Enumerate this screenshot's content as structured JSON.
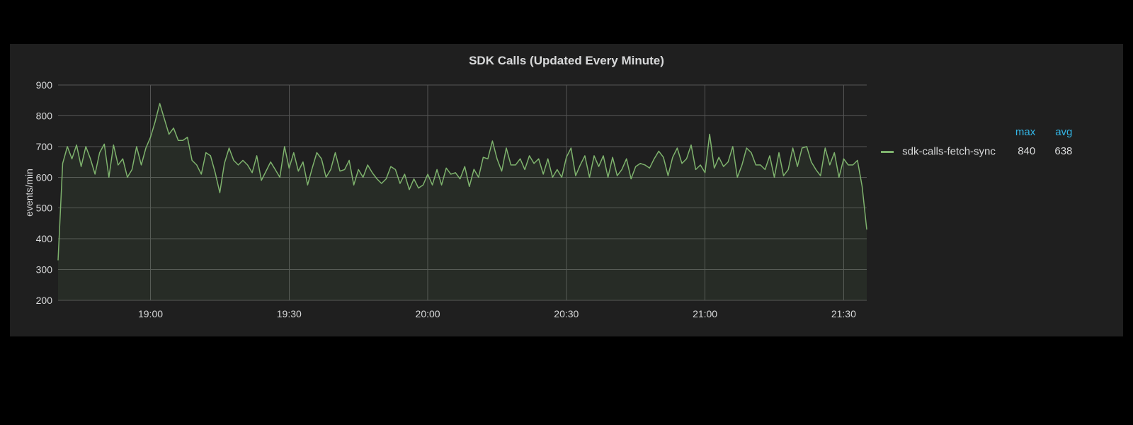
{
  "panel": {
    "title": "SDK Calls (Updated Every Minute)"
  },
  "legend": {
    "columns": {
      "max": "max",
      "avg": "avg"
    },
    "series": [
      {
        "name": "sdk-calls-fetch-sync",
        "color": "#7eb26d",
        "max": "840",
        "avg": "638"
      }
    ]
  },
  "chart_data": {
    "type": "line",
    "title": "SDK Calls (Updated Every Minute)",
    "xlabel": "",
    "ylabel": "events/min",
    "ylim": [
      200,
      900
    ],
    "y_ticks": [
      200,
      300,
      400,
      500,
      600,
      700,
      800,
      900
    ],
    "x_ticks": [
      "19:00",
      "19:30",
      "20:00",
      "20:30",
      "21:00",
      "21:30"
    ],
    "x_range_minutes": [
      0,
      175
    ],
    "series": [
      {
        "name": "sdk-calls-fetch-sync",
        "color": "#7eb26d",
        "x_minutes": [
          0,
          1,
          2,
          3,
          4,
          5,
          6,
          7,
          8,
          9,
          10,
          11,
          12,
          13,
          14,
          15,
          16,
          17,
          18,
          19,
          20,
          21,
          22,
          23,
          24,
          25,
          26,
          27,
          28,
          29,
          30,
          31,
          32,
          33,
          34,
          35,
          36,
          37,
          38,
          39,
          40,
          41,
          42,
          43,
          44,
          45,
          46,
          47,
          48,
          49,
          50,
          51,
          52,
          53,
          54,
          55,
          56,
          57,
          58,
          59,
          60,
          61,
          62,
          63,
          64,
          65,
          66,
          67,
          68,
          69,
          70,
          71,
          72,
          73,
          74,
          75,
          76,
          77,
          78,
          79,
          80,
          81,
          82,
          83,
          84,
          85,
          86,
          87,
          88,
          89,
          90,
          91,
          92,
          93,
          94,
          95,
          96,
          97,
          98,
          99,
          100,
          101,
          102,
          103,
          104,
          105,
          106,
          107,
          108,
          109,
          110,
          111,
          112,
          113,
          114,
          115,
          116,
          117,
          118,
          119,
          120,
          121,
          122,
          123,
          124,
          125,
          126,
          127,
          128,
          129,
          130,
          131,
          132,
          133,
          134,
          135,
          136,
          137,
          138,
          139,
          140,
          141,
          142,
          143,
          144,
          145,
          146,
          147,
          148,
          149,
          150,
          151,
          152,
          153,
          154,
          155,
          156,
          157,
          158,
          159,
          160,
          161,
          162,
          163,
          164,
          165,
          166,
          167,
          168,
          169,
          170,
          171,
          172,
          173,
          174,
          175
        ],
        "values": [
          330,
          645,
          700,
          660,
          705,
          635,
          700,
          660,
          610,
          680,
          708,
          600,
          705,
          640,
          660,
          600,
          625,
          700,
          640,
          695,
          730,
          780,
          840,
          790,
          740,
          760,
          720,
          720,
          730,
          655,
          640,
          610,
          680,
          670,
          615,
          550,
          645,
          695,
          655,
          640,
          655,
          640,
          615,
          670,
          590,
          620,
          650,
          625,
          600,
          700,
          630,
          680,
          620,
          650,
          575,
          630,
          680,
          660,
          600,
          625,
          680,
          620,
          625,
          655,
          575,
          625,
          600,
          640,
          615,
          595,
          580,
          595,
          635,
          625,
          580,
          610,
          560,
          595,
          565,
          575,
          610,
          575,
          625,
          575,
          630,
          610,
          615,
          595,
          635,
          570,
          626,
          600,
          665,
          660,
          718,
          660,
          620,
          695,
          640,
          640,
          660,
          625,
          670,
          645,
          660,
          610,
          660,
          600,
          625,
          600,
          665,
          695,
          605,
          640,
          670,
          600,
          670,
          635,
          670,
          600,
          665,
          605,
          625,
          660,
          595,
          635,
          645,
          640,
          630,
          660,
          685,
          665,
          605,
          665,
          695,
          645,
          660,
          705,
          625,
          640,
          615,
          740,
          630,
          665,
          635,
          650,
          700,
          600,
          640,
          695,
          680,
          640,
          640,
          625,
          670,
          600,
          680,
          605,
          625,
          695,
          635,
          695,
          700,
          650,
          625,
          605,
          695,
          640,
          680,
          600,
          660,
          640,
          640,
          655,
          570,
          430
        ]
      }
    ]
  }
}
